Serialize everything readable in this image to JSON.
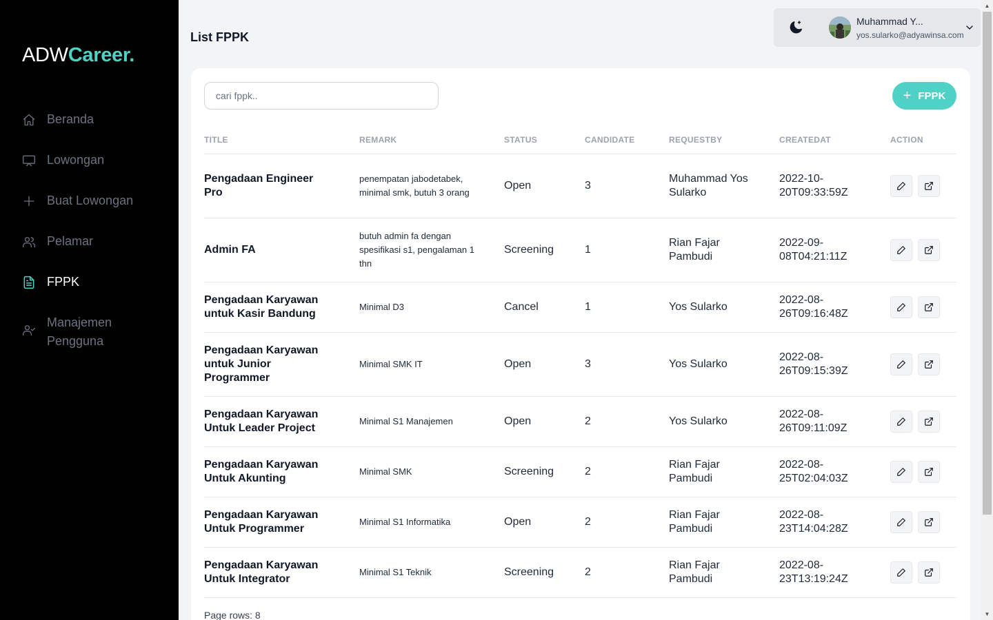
{
  "brand": {
    "part1": "ADW",
    "part2": "Career."
  },
  "sidebar": {
    "items": [
      {
        "label": "Beranda",
        "icon": "home-icon"
      },
      {
        "label": "Lowongan",
        "icon": "monitor-icon"
      },
      {
        "label": "Buat Lowongan",
        "icon": "plus-icon"
      },
      {
        "label": "Pelamar",
        "icon": "users-icon"
      },
      {
        "label": "FPPK",
        "icon": "document-icon",
        "active": true
      },
      {
        "label": "Manajemen Pengguna",
        "icon": "user-check-icon"
      }
    ]
  },
  "header": {
    "title": "List FPPK",
    "user_name": "Muhammad Y...",
    "user_email": "yos.sularko@adyawinsa.com"
  },
  "search": {
    "placeholder": "cari fppk.."
  },
  "add_button": {
    "label": "FPPK"
  },
  "table": {
    "columns": [
      "TITLE",
      "REMARK",
      "STATUS",
      "CANDIDATE",
      "REQUESTBY",
      "CREATEDAT",
      "ACTION"
    ],
    "rows": [
      {
        "title": "Pengadaan Engineer Pro",
        "remark": "penempatan jabodetabek, minimal smk, butuh 3 orang",
        "status": "Open",
        "candidate": "3",
        "requestby": "Muhammad Yos Sularko",
        "createdat": "2022-10-20T09:33:59Z"
      },
      {
        "title": "Admin FA",
        "remark": "butuh admin fa dengan spesifikasi s1, pengalaman 1 thn",
        "status": "Screening",
        "candidate": "1",
        "requestby": "Rian Fajar Pambudi",
        "createdat": "2022-09-08T04:21:11Z"
      },
      {
        "title": "Pengadaan Karyawan untuk Kasir Bandung",
        "remark": "Minimal D3",
        "status": "Cancel",
        "candidate": "1",
        "requestby": "Yos Sularko",
        "createdat": "2022-08-26T09:16:48Z"
      },
      {
        "title": "Pengadaan Karyawan untuk Junior Programmer",
        "remark": "Minimal SMK IT",
        "status": "Open",
        "candidate": "3",
        "requestby": "Yos Sularko",
        "createdat": "2022-08-26T09:15:39Z"
      },
      {
        "title": "Pengadaan Karyawan Untuk Leader Project",
        "remark": "Minimal S1 Manajemen",
        "status": "Open",
        "candidate": "2",
        "requestby": "Yos Sularko",
        "createdat": "2022-08-26T09:11:09Z"
      },
      {
        "title": "Pengadaan Karyawan Untuk Akunting",
        "remark": "Minimal SMK",
        "status": "Screening",
        "candidate": "2",
        "requestby": "Rian Fajar Pambudi",
        "createdat": "2022-08-25T02:04:03Z"
      },
      {
        "title": "Pengadaan Karyawan Untuk Programmer",
        "remark": "Minimal S1 Informatika",
        "status": "Open",
        "candidate": "2",
        "requestby": "Rian Fajar Pambudi",
        "createdat": "2022-08-23T14:04:28Z"
      },
      {
        "title": "Pengadaan Karyawan Untuk Integrator",
        "remark": "Minimal S1 Teknik",
        "status": "Screening",
        "candidate": "2",
        "requestby": "Rian Fajar Pambudi",
        "createdat": "2022-08-23T13:19:24Z"
      }
    ]
  },
  "pagination": {
    "rows_label": "Page rows: 8"
  },
  "colors": {
    "accent": "#4fd1c5",
    "sidebar_bg": "#000000",
    "page_bg": "#f3f4f6"
  }
}
